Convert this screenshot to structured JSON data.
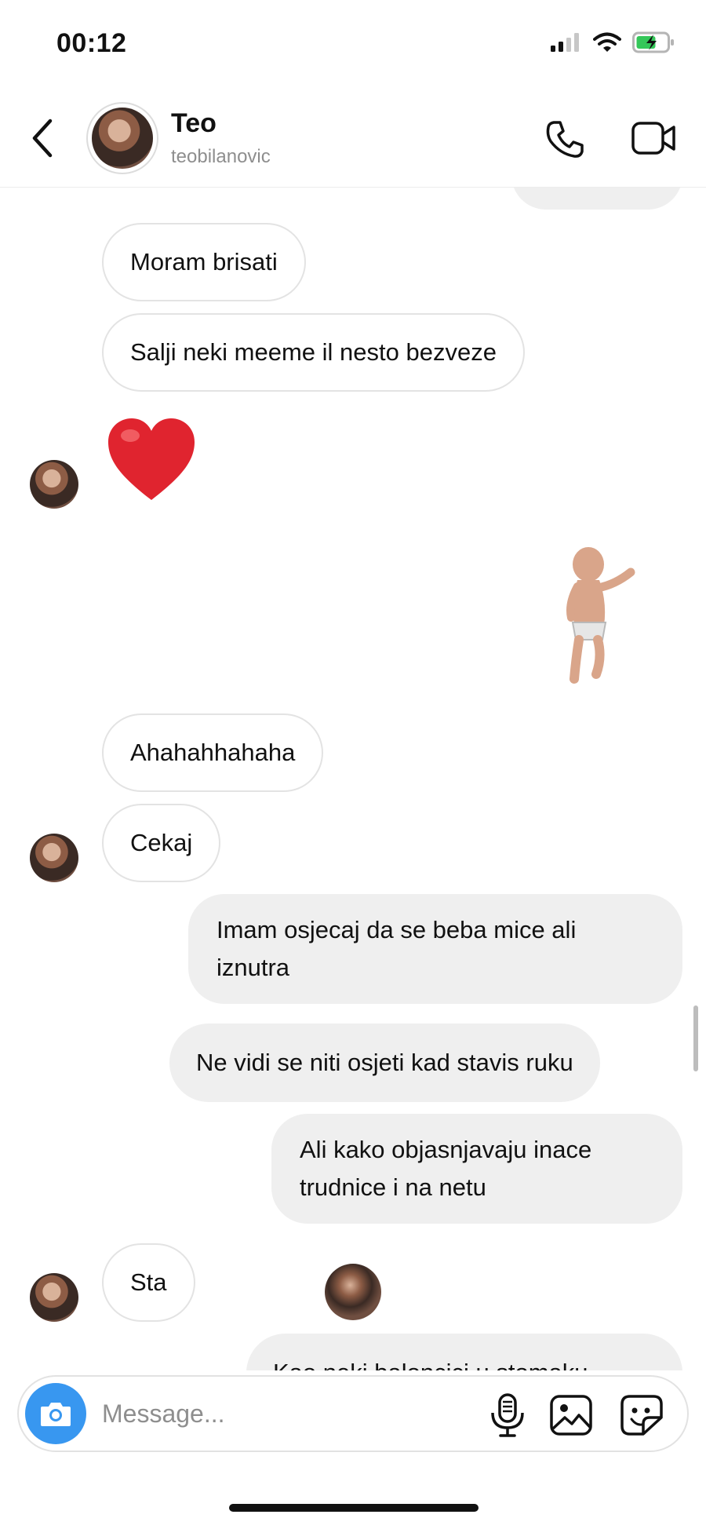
{
  "status_bar": {
    "time": "00:12",
    "icons": [
      "signal-icon",
      "wifi-icon",
      "battery-charging-icon"
    ],
    "battery_color": "#34c759"
  },
  "header": {
    "name": "Teo",
    "username": "teobilanovic",
    "icons": [
      "back-arrow-icon",
      "phone-icon",
      "video-camera-icon"
    ]
  },
  "messages": [
    {
      "from": "them",
      "text": "Moram brisati"
    },
    {
      "from": "them",
      "text": "Salji neki meeme il nesto bezveze"
    },
    {
      "from": "them",
      "type": "emoji",
      "icon": "heart-icon",
      "color": "#e0242f"
    },
    {
      "from": "me",
      "type": "sticker",
      "icon": "dancing-baby-sticker"
    },
    {
      "from": "them",
      "text": "Ahahahhahaha"
    },
    {
      "from": "them",
      "text": "Cekaj"
    },
    {
      "from": "me",
      "text": "Imam osjecaj da se beba mice ali iznutra"
    },
    {
      "from": "me",
      "text": "Ne vidi se niti osjeti kad stavis ruku"
    },
    {
      "from": "me",
      "text": "Ali kako objasnjavaju inace trudnice i na netu"
    },
    {
      "from": "them",
      "text": "Sta"
    },
    {
      "from": "me",
      "text": "Kao neki baloncici u stomaku"
    }
  ],
  "composer": {
    "placeholder": "Message...",
    "icons": [
      "camera-icon",
      "microphone-icon",
      "gallery-icon",
      "sticker-icon"
    ],
    "camera_button_color": "#3897f0"
  }
}
